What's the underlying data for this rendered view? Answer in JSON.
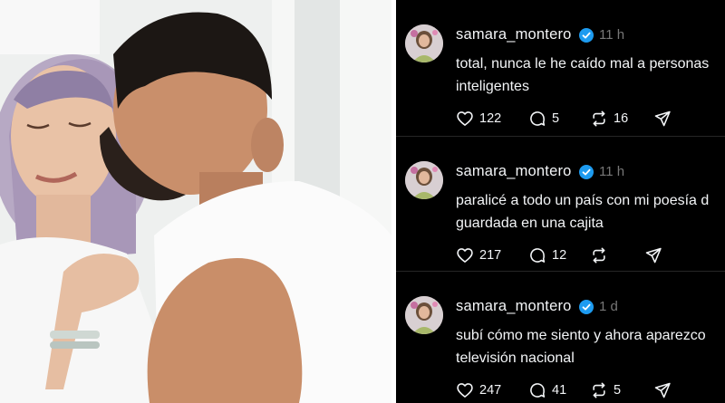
{
  "colors": {
    "feed_background": "#000000",
    "text_primary": "#f3f5f7",
    "text_secondary": "#777777",
    "verified": "#1d9bf0",
    "separator": "#262626"
  },
  "photo": {
    "icon": "photo-of-couple"
  },
  "posts": [
    {
      "username": "samara_montero",
      "verified": true,
      "time": "11 h",
      "text_line1": "total, nunca le he caído mal a personas",
      "text_line2": "inteligentes",
      "likes": "122",
      "replies": "5",
      "reposts": "16"
    },
    {
      "username": "samara_montero",
      "verified": true,
      "time": "11 h",
      "text_line1": "paralicé a todo un país con mi poesía d",
      "text_line2": "guardada en una cajita",
      "likes": "217",
      "replies": "12",
      "reposts": ""
    },
    {
      "username": "samara_montero",
      "verified": true,
      "time": "1 d",
      "text_line1": "subí cómo me siento y ahora aparezco",
      "text_line2": "televisión nacional",
      "likes": "247",
      "replies": "41",
      "reposts": "5"
    }
  ]
}
